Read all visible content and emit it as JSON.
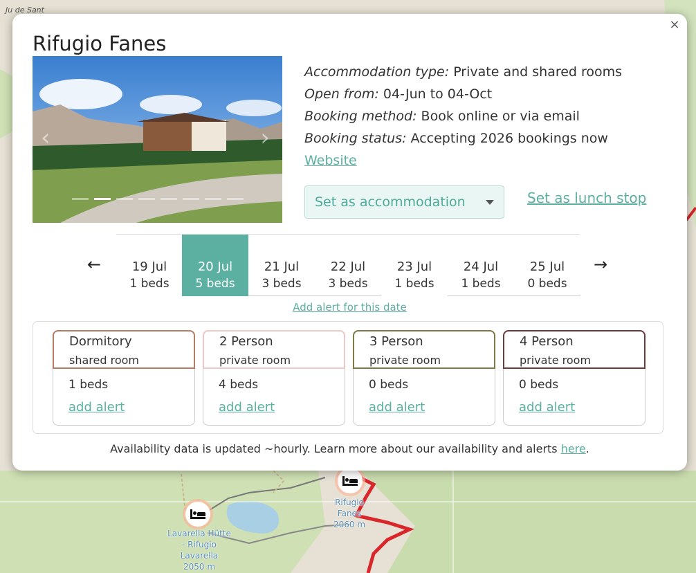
{
  "map": {
    "corner_label": "Ju de Sant",
    "markers": [
      {
        "label_lines": [
          "Lavarella Hütte",
          "- Rifugio",
          "Lavarella",
          "2050 m"
        ]
      },
      {
        "label_lines": [
          "Rifugio",
          "Fanes",
          "2060 m"
        ]
      }
    ]
  },
  "popup": {
    "close_label": "×",
    "title": "Rifugio Fanes",
    "photo": {
      "prev_label": "‹",
      "next_label": "›",
      "slide_count": 8,
      "active_slide": 1
    },
    "info": {
      "accommodation_type_label": "Accommodation type:",
      "accommodation_type_value": "Private and shared rooms",
      "open_label": "Open from:",
      "open_value": "04-Jun to 04-Oct",
      "booking_method_label": "Booking method:",
      "booking_method_value": "Book online or via email",
      "booking_status_label": "Booking status:",
      "booking_status_value": "Accepting 2026 bookings now",
      "website_label": "Website"
    },
    "set_accommodation_label": "Set as accommodation",
    "set_lunch_label": "Set as lunch stop",
    "dates_prev": "←",
    "dates_next": "→",
    "dates": [
      {
        "date": "19 Jul",
        "beds": "1 beds"
      },
      {
        "date": "20 Jul",
        "beds": "5 beds"
      },
      {
        "date": "21 Jul",
        "beds": "3 beds"
      },
      {
        "date": "22 Jul",
        "beds": "3 beds"
      },
      {
        "date": "23 Jul",
        "beds": "1 beds"
      },
      {
        "date": "24 Jul",
        "beds": "1 beds"
      },
      {
        "date": "25 Jul",
        "beds": "0 beds"
      }
    ],
    "selected_date_index": 1,
    "add_alert_date_label": "Add alert for this date",
    "rooms": [
      {
        "name": "Dormitory",
        "type": "shared room",
        "beds": "1 beds",
        "alert": "add alert",
        "color": "#b87a62"
      },
      {
        "name": "2 Person",
        "type": "private room",
        "beds": "4 beds",
        "alert": "add alert",
        "color": "#f0c8c8"
      },
      {
        "name": "3 Person",
        "type": "private room",
        "beds": "0 beds",
        "alert": "add alert",
        "color": "#7d7a48"
      },
      {
        "name": "4 Person",
        "type": "private room",
        "beds": "0 beds",
        "alert": "add alert",
        "color": "#6b3a3a"
      }
    ],
    "footnote_text": "Availability data is updated ~hourly. Learn more about our availability and alerts ",
    "footnote_link": "here",
    "footnote_end": "."
  },
  "colors": {
    "accent": "#5bb0a2",
    "route": "#d9262b"
  }
}
